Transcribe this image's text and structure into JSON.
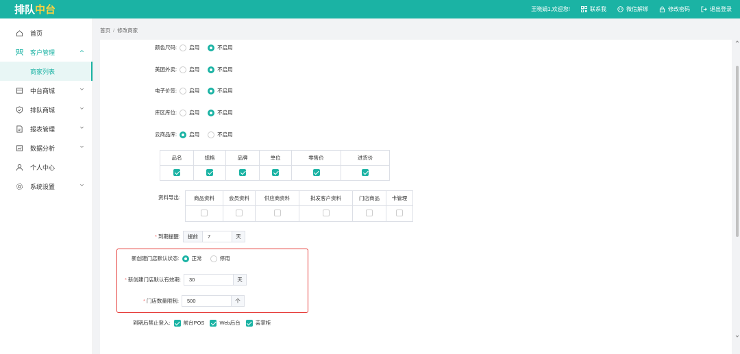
{
  "header": {
    "logo_part1": "排队",
    "logo_part2": "中台",
    "welcome": "王晓娟1,欢迎您!",
    "contact": "联系我",
    "wechat_unbind": "微信解绑",
    "change_password": "修改密码",
    "logout": "退出登录"
  },
  "sidebar": {
    "items": [
      {
        "label": "首页",
        "icon": "home-icon"
      },
      {
        "label": "客户管理",
        "icon": "customer-icon"
      },
      {
        "label": "中台商城",
        "icon": "store-icon"
      },
      {
        "label": "排队商城",
        "icon": "shield-icon"
      },
      {
        "label": "报表管理",
        "icon": "report-icon"
      },
      {
        "label": "数据分析",
        "icon": "chart-icon"
      },
      {
        "label": "个人中心",
        "icon": "user-icon"
      },
      {
        "label": "系统设置",
        "icon": "gear-icon"
      }
    ],
    "sub_item": "商家列表",
    "accent": "#1bb3a4"
  },
  "breadcrumb": {
    "home": "首页",
    "separator": "/",
    "current": "修改商家"
  },
  "form": {
    "radio_rows": [
      {
        "label": "颜色尺码:",
        "opt1": "启用",
        "opt2": "不启用",
        "selected": "不启用"
      },
      {
        "label": "美团外卖:",
        "opt1": "启用",
        "opt2": "不启用",
        "selected": "不启用"
      },
      {
        "label": "电子价签:",
        "opt1": "启用",
        "opt2": "不启用",
        "selected": "不启用"
      },
      {
        "label": "库区库位:",
        "opt1": "启用",
        "opt2": "不启用",
        "selected": "不启用"
      },
      {
        "label": "云商品库:",
        "opt1": "启用",
        "opt2": "不启用",
        "selected": "启用"
      }
    ],
    "cloud_columns": [
      "品名",
      "规格",
      "品牌",
      "单位",
      "零售价",
      "进货价"
    ],
    "export_label": "资料导出:",
    "export_columns": [
      "商品资料",
      "会员资料",
      "供应商资料",
      "批发客户资料",
      "门店商品",
      "卡管理"
    ],
    "expiry": {
      "label": "到期提醒:",
      "prefix": "提前",
      "value": "7",
      "unit": "天"
    },
    "store_status": {
      "label": "新创建门店默认状态:",
      "opt1": "正常",
      "opt2": "停用",
      "selected": "正常"
    },
    "store_validity": {
      "label": "新创建门店默认有效期:",
      "value": "30",
      "unit": "天"
    },
    "store_limit": {
      "label": "门店数量限制:",
      "value": "500",
      "unit": "个"
    },
    "login_block": {
      "label": "到期后禁止登入:",
      "options": [
        "前台POS",
        "Web后台",
        "芸掌柜"
      ]
    },
    "highlight_color": "#e53935"
  }
}
